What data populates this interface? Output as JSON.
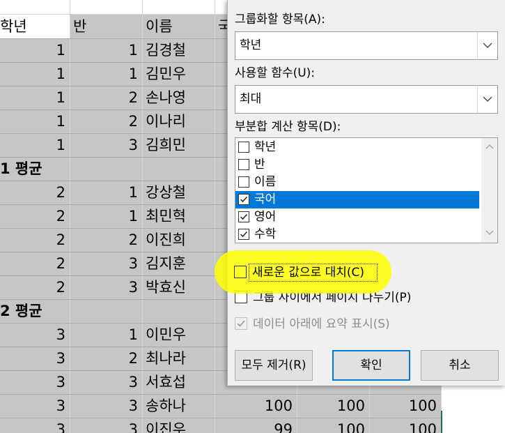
{
  "sheet": {
    "header": [
      "학년",
      "반",
      "이름",
      "국"
    ],
    "rows": [
      {
        "grade": "1",
        "class": "1",
        "name": "김경철"
      },
      {
        "grade": "1",
        "class": "1",
        "name": "김민우"
      },
      {
        "grade": "1",
        "class": "2",
        "name": "손나영"
      },
      {
        "grade": "1",
        "class": "2",
        "name": "이나리"
      },
      {
        "grade": "1",
        "class": "3",
        "name": "김희민"
      },
      {
        "subtotal": "1 평균"
      },
      {
        "grade": "2",
        "class": "1",
        "name": "강상철"
      },
      {
        "grade": "2",
        "class": "1",
        "name": "최민혁"
      },
      {
        "grade": "2",
        "class": "2",
        "name": "이진희"
      },
      {
        "grade": "2",
        "class": "3",
        "name": "김지훈"
      },
      {
        "grade": "2",
        "class": "3",
        "name": "박효신"
      },
      {
        "subtotal": "2 평균"
      },
      {
        "grade": "3",
        "class": "1",
        "name": "이민우"
      },
      {
        "grade": "3",
        "class": "2",
        "name": "최나라"
      },
      {
        "grade": "3",
        "class": "3",
        "name": "서효섭"
      },
      {
        "grade": "3",
        "class": "3",
        "name": "송하나",
        "s1": "100",
        "s2": "100",
        "s3": "100"
      },
      {
        "grade": "3",
        "class": "3",
        "name": "이진우",
        "s1": "99",
        "s2": "100",
        "s3": "100"
      }
    ]
  },
  "dialog": {
    "group_by_label": "그룹화할 항목(A):",
    "group_by_value": "학년",
    "function_label": "사용할 함수(U):",
    "function_value": "최대",
    "add_subtotal_label": "부분합 계산 항목(D):",
    "fields": [
      {
        "label": "학년",
        "checked": false
      },
      {
        "label": "반",
        "checked": false
      },
      {
        "label": "이름",
        "checked": false
      },
      {
        "label": "국어",
        "checked": true,
        "selected": true
      },
      {
        "label": "영어",
        "checked": true
      },
      {
        "label": "수학",
        "checked": true
      }
    ],
    "replace_label": "새로운 값으로 대치(C)",
    "replace_checked": false,
    "page_break_label": "그룹 사이에서 페이지 나누기(P)",
    "page_break_checked": false,
    "summary_label": "데이터 아래에 요약 표시(S)",
    "summary_checked": true,
    "remove_all_label": "모두 제거(R)",
    "ok_label": "확인",
    "cancel_label": "취소"
  },
  "icons": {
    "dropdown": "chevron-down-icon",
    "check": "checkmark-icon",
    "scroll_up": "scroll-up-icon",
    "scroll_down": "scroll-down-icon"
  },
  "colors": {
    "selection_gray": "#c6c6c6",
    "list_highlight": "#0078d7",
    "annotation_highlight": "#ffff00",
    "excel_green": "#1f7244"
  }
}
